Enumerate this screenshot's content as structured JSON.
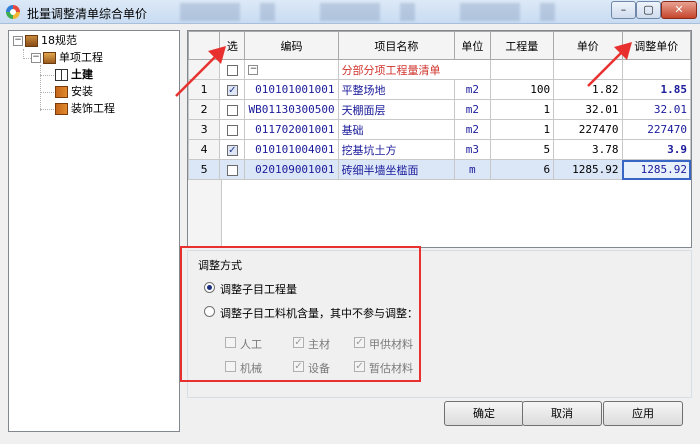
{
  "window": {
    "title": "批量调整清单综合单价",
    "min_glyph": "–",
    "max_glyph": "▢",
    "close_glyph": "✕"
  },
  "tree": {
    "root": "18规范",
    "child": "单项工程",
    "leaves": [
      "土建",
      "安装",
      "装饰工程"
    ],
    "selected_leaf": "土建"
  },
  "grid": {
    "columns": [
      "选",
      "编码",
      "项目名称",
      "单位",
      "工程量",
      "单价",
      "调整单价"
    ],
    "group_row": {
      "label": "分部分项工程量清单",
      "expand_glyph": "−"
    },
    "rows": [
      {
        "no": "1",
        "checked": true,
        "code": "010101001001",
        "name": "平整场地",
        "unit": "m2",
        "qty": "100",
        "price": "1.82",
        "adj": "1.85",
        "adj_bold": true
      },
      {
        "no": "2",
        "checked": false,
        "code": "WB01130300500",
        "name": "天棚面层",
        "unit": "m2",
        "qty": "1",
        "price": "32.01",
        "adj": "32.01",
        "adj_bold": false
      },
      {
        "no": "3",
        "checked": false,
        "code": "011702001001",
        "name": "基础",
        "unit": "m2",
        "qty": "1",
        "price": "227470",
        "adj": "227470",
        "adj_bold": false
      },
      {
        "no": "4",
        "checked": true,
        "code": "010101004001",
        "name": "挖基坑土方",
        "unit": "m3",
        "qty": "5",
        "price": "3.78",
        "adj": "3.9",
        "adj_bold": true
      },
      {
        "no": "5",
        "checked": false,
        "code": "020109001001",
        "name": "砖细半墙坐槛面",
        "unit": "m",
        "qty": "6",
        "price": "1285.92",
        "adj": "1285.92",
        "adj_bold": false
      }
    ],
    "selected_row": "5"
  },
  "adjust": {
    "legend": "调整方式",
    "option1": "调整子目工程量",
    "option2": "调整子目工料机含量，其中不参与调整：",
    "selected": "option1",
    "items": {
      "labor": "人工",
      "main_material": "主材",
      "supplied_material": "甲供材料",
      "machine": "机械",
      "equipment": "设备",
      "temp_material": "暂估材料"
    }
  },
  "buttons": {
    "ok": "确定",
    "cancel": "取消",
    "apply": "应用"
  },
  "colors": {
    "annotation": "#e8312f",
    "selection": "#dbe7f7",
    "code_text": "#1a1a9a",
    "group_text": "#d0342c"
  }
}
